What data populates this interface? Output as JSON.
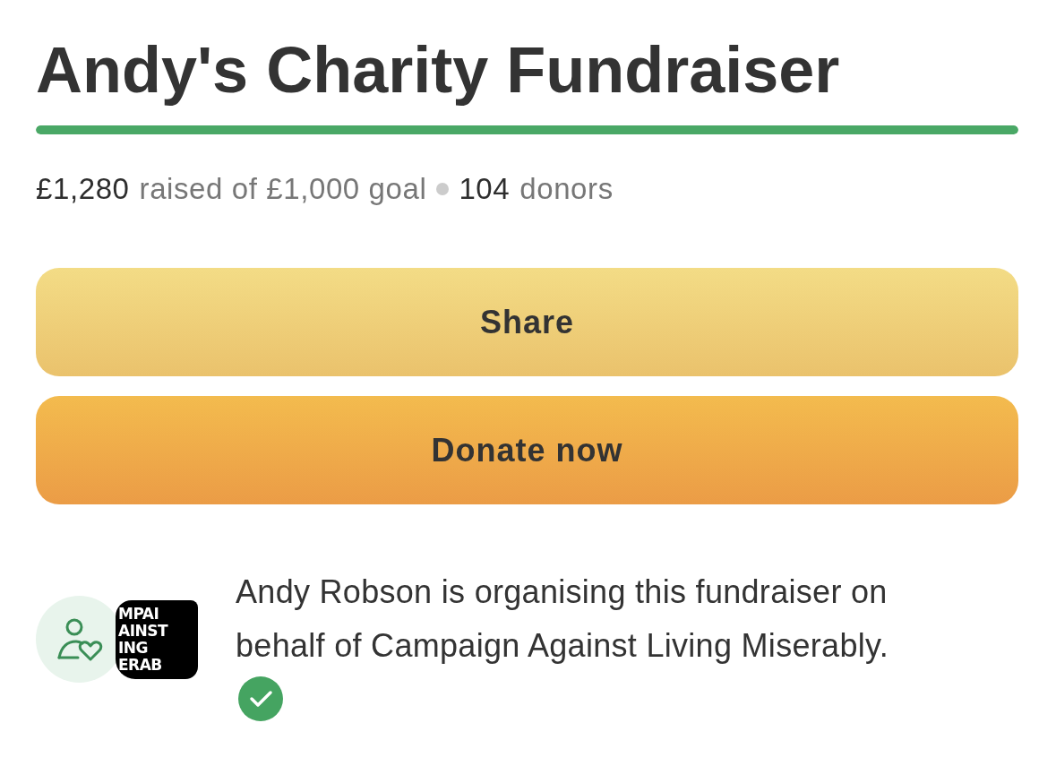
{
  "title": "Andy's Charity Fundraiser",
  "progress": {
    "level": 1
  },
  "stats": {
    "raised": "£1,280",
    "raised_label": "raised of £1,000 goal",
    "donors": "104",
    "donors_label": "donors"
  },
  "buttons": [
    {
      "label": "Share",
      "kind": "share"
    },
    {
      "label": "Donate now",
      "kind": "donate"
    }
  ],
  "organiser": {
    "logo_lines": [
      "MPAI",
      "AINST",
      "ING",
      "ERAB"
    ],
    "text": "Andy Robson is organising this fundraiser on behalf of Campaign Against Living Miserably.",
    "verified": true
  }
}
